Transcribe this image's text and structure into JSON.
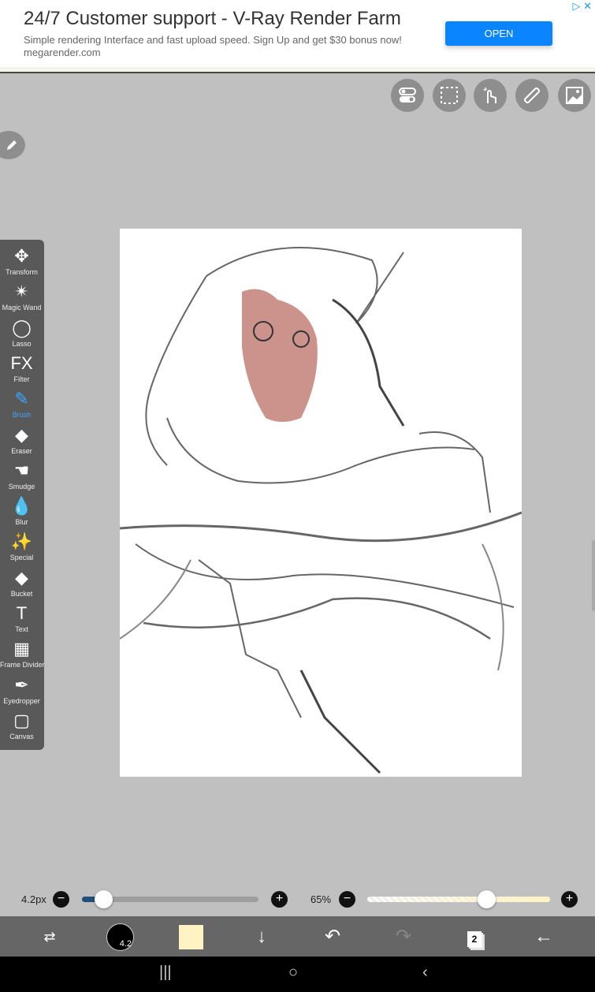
{
  "ad": {
    "title": "24/7 Customer support - V-Ray Render Farm",
    "description": "Simple rendering Interface and fast upload speed. Sign Up and get $30 bonus now!",
    "url": "megarender.com",
    "button": "OPEN",
    "adchoices": "▷ ✕"
  },
  "top_buttons": [
    "toggle-settings",
    "selection",
    "touch-gesture",
    "ruler",
    "reference-image"
  ],
  "tools": [
    {
      "label": "Transform",
      "icon": "✥"
    },
    {
      "label": "Magic Wand",
      "icon": "✴"
    },
    {
      "label": "Lasso",
      "icon": "◯"
    },
    {
      "label": "Filter",
      "icon": "FX"
    },
    {
      "label": "Brush",
      "icon": "✎"
    },
    {
      "label": "Eraser",
      "icon": "◆"
    },
    {
      "label": "Smudge",
      "icon": "☚"
    },
    {
      "label": "Blur",
      "icon": "💧"
    },
    {
      "label": "Special",
      "icon": "✨"
    },
    {
      "label": "Bucket",
      "icon": "◆"
    },
    {
      "label": "Text",
      "icon": "T"
    },
    {
      "label": "Frame Divider",
      "icon": "▦"
    },
    {
      "label": "Eyedropper",
      "icon": "✒"
    },
    {
      "label": "Canvas",
      "icon": "▢"
    }
  ],
  "active_tool": "Brush",
  "brush": {
    "size_label": "4.2px",
    "size_fraction": 0.12,
    "opacity_label": "65%",
    "opacity_fraction": 0.65,
    "preview_size": "4.2"
  },
  "colors": {
    "accent": "#3ea6ff",
    "slider_fill": "#1f4e79",
    "current_color": "#fff3c4",
    "skin": "#b5655a"
  },
  "layers": {
    "count": "2"
  },
  "nav": {
    "recents": "|||",
    "home": "○",
    "back": "‹"
  }
}
